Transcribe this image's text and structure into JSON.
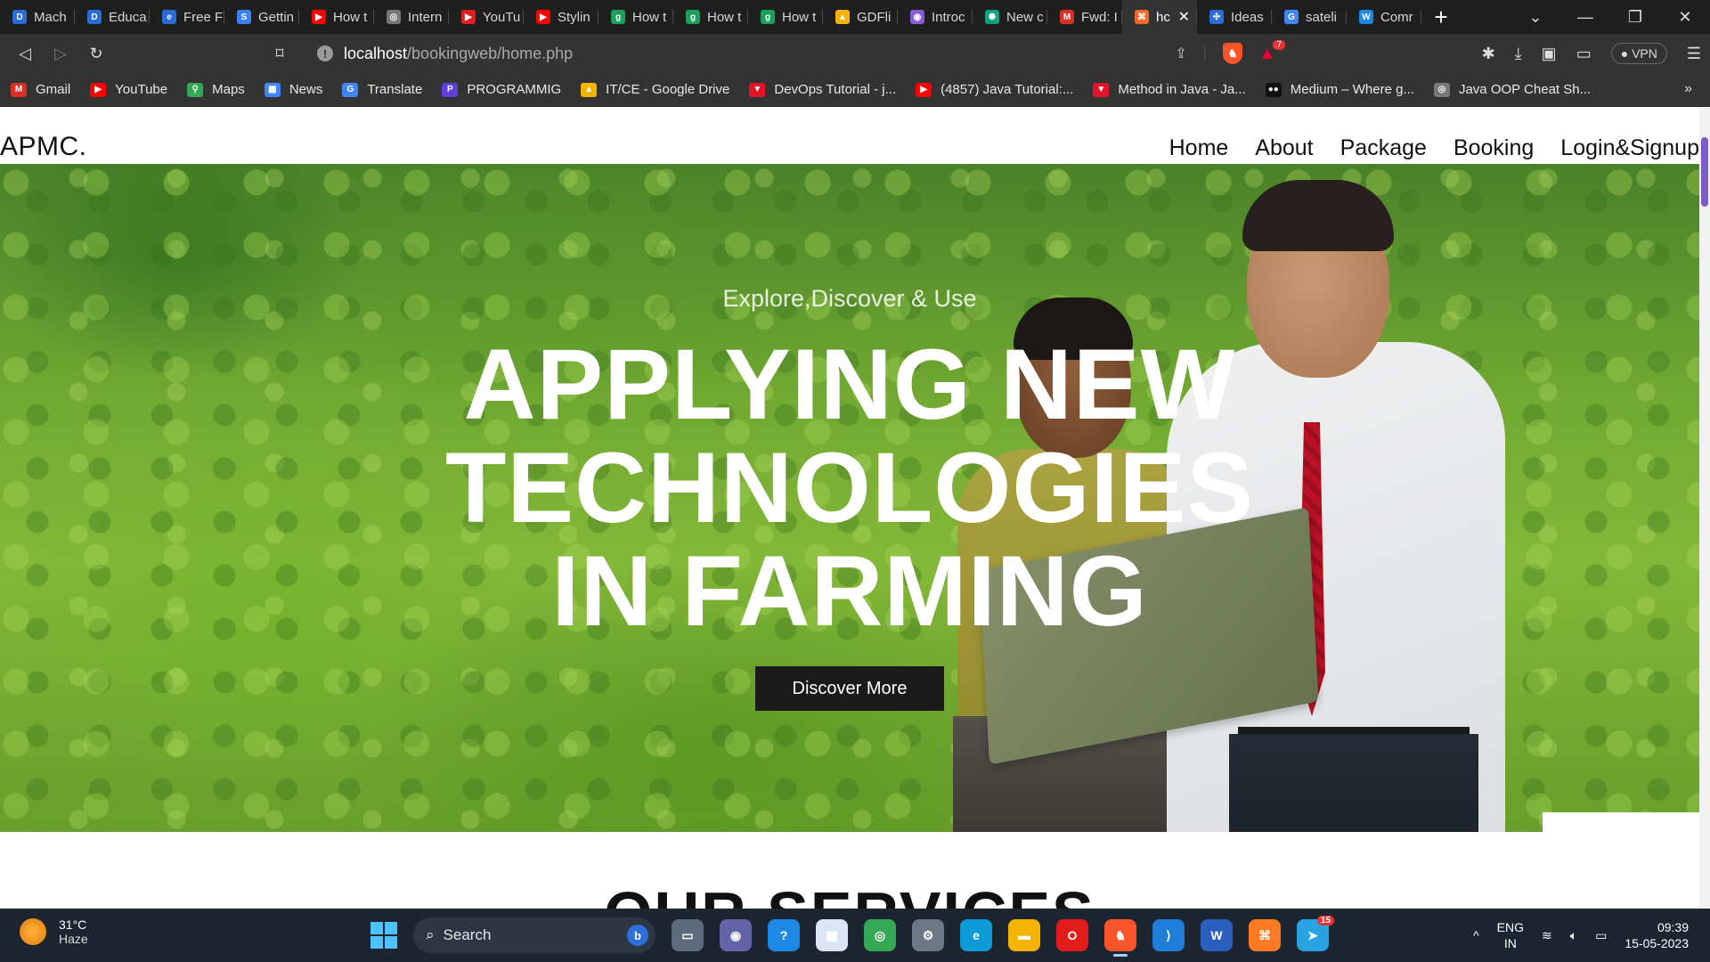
{
  "browser": {
    "tabs": [
      {
        "label": "Mach",
        "color": "#2b6cd6",
        "icon": "D"
      },
      {
        "label": "Educa",
        "color": "#2b6cd6",
        "icon": "D"
      },
      {
        "label": "Free F",
        "color": "#2b6cd6",
        "icon": "e"
      },
      {
        "label": "Gettin",
        "color": "#3b82f6",
        "icon": "S"
      },
      {
        "label": "How t",
        "color": "#ff0000",
        "icon": "▶"
      },
      {
        "label": "Intern",
        "color": "#777777",
        "icon": "◎"
      },
      {
        "label": "YouTu",
        "color": "#e02020",
        "icon": "▶"
      },
      {
        "label": "Stylin",
        "color": "#ff0000",
        "icon": "▶"
      },
      {
        "label": "How t",
        "color": "#1b9f5a",
        "icon": "g"
      },
      {
        "label": "How t",
        "color": "#1b9f5a",
        "icon": "g"
      },
      {
        "label": "How t",
        "color": "#1b9f5a",
        "icon": "g"
      },
      {
        "label": "GDFli",
        "color": "#f3b400",
        "icon": "▲"
      },
      {
        "label": "Introc",
        "color": "#8a5bd6",
        "icon": "◉"
      },
      {
        "label": "New c",
        "color": "#10a37f",
        "icon": "✺"
      },
      {
        "label": "Fwd: I",
        "color": "#d93025",
        "icon": "M"
      },
      {
        "label": "hc",
        "color": "#f06a2a",
        "icon": "⌘",
        "active": true
      },
      {
        "label": "Ideas",
        "color": "#2b6cd6",
        "icon": "✣"
      },
      {
        "label": "sateli",
        "color": "#4285f4",
        "icon": "G"
      },
      {
        "label": "Comr",
        "color": "#1e88e5",
        "icon": "W"
      }
    ],
    "active_tab_close": "✕",
    "new_tab": "+",
    "window_controls": [
      "⌄",
      "—",
      "❐",
      "✕"
    ],
    "url_host": "localhost",
    "url_path": "/bookingweb/home.php",
    "vpn_label": "VPN",
    "rewards_count": "7",
    "bookmarks": [
      {
        "label": "Gmail",
        "color": "#d93025",
        "icon": "M"
      },
      {
        "label": "YouTube",
        "color": "#ff0000",
        "icon": "▶"
      },
      {
        "label": "Maps",
        "color": "#34a853",
        "icon": "⚲"
      },
      {
        "label": "News",
        "color": "#4285f4",
        "icon": "▦"
      },
      {
        "label": "Translate",
        "color": "#4285f4",
        "icon": "G"
      },
      {
        "label": "PROGRAMMIG",
        "color": "#5b3fd6",
        "icon": "P"
      },
      {
        "label": "IT/CE - Google Drive",
        "color": "#f3b400",
        "icon": "▲"
      },
      {
        "label": "DevOps Tutorial - j...",
        "color": "#e3142a",
        "icon": "▼"
      },
      {
        "label": "(4857) Java Tutorial:...",
        "color": "#ff0000",
        "icon": "▶"
      },
      {
        "label": "Method in Java - Ja...",
        "color": "#e3142a",
        "icon": "▼"
      },
      {
        "label": "Medium – Where g...",
        "color": "#111111",
        "icon": "●●"
      },
      {
        "label": "Java OOP Cheat Sh...",
        "color": "#777777",
        "icon": "◎"
      }
    ],
    "bookmarks_more": "»"
  },
  "site": {
    "logo": "APMC.",
    "nav": [
      "Home",
      "About",
      "Package",
      "Booking",
      "Login&Signup"
    ],
    "hero": {
      "subtitle": "Explore,Discover & Use",
      "headline_line1": "APPLYING NEW",
      "headline_line2": "TECHNOLOGIES",
      "headline_line3": "IN FARMING",
      "cta": "Discover More",
      "prev": "‹",
      "next": "›"
    },
    "section_title": "OUR SERVICES"
  },
  "taskbar": {
    "temperature": "31°C",
    "condition": "Haze",
    "search_placeholder": "Search",
    "apps": [
      {
        "name": "file-explorer-preview",
        "color": "#5d6c7c",
        "icon": "▭"
      },
      {
        "name": "teams",
        "color": "#6264a7",
        "icon": "◉"
      },
      {
        "name": "help",
        "color": "#1e88e5",
        "icon": "?"
      },
      {
        "name": "whiteboard",
        "color": "#d9e4f5",
        "icon": "▦"
      },
      {
        "name": "chrome",
        "color": "#34a853",
        "icon": "◎"
      },
      {
        "name": "settings",
        "color": "#6b7785",
        "icon": "⚙"
      },
      {
        "name": "edge",
        "color": "#0f9bd7",
        "icon": "e"
      },
      {
        "name": "folder",
        "color": "#f3b400",
        "icon": "▬"
      },
      {
        "name": "opera",
        "color": "#e21b1b",
        "icon": "O"
      },
      {
        "name": "brave",
        "color": "#fb542b",
        "icon": "♞",
        "active": true
      },
      {
        "name": "vscode",
        "color": "#1f7fd8",
        "icon": "⟩"
      },
      {
        "name": "word",
        "color": "#2b5fbd",
        "icon": "W"
      },
      {
        "name": "xampp",
        "color": "#fb7a24",
        "icon": "⌘"
      },
      {
        "name": "telegram",
        "color": "#2aa3e3",
        "icon": "➤",
        "badge": "15"
      }
    ],
    "tray_arrow": "^",
    "lang_line1": "ENG",
    "lang_line2": "IN",
    "time": "09:39",
    "date": "15-05-2023"
  }
}
